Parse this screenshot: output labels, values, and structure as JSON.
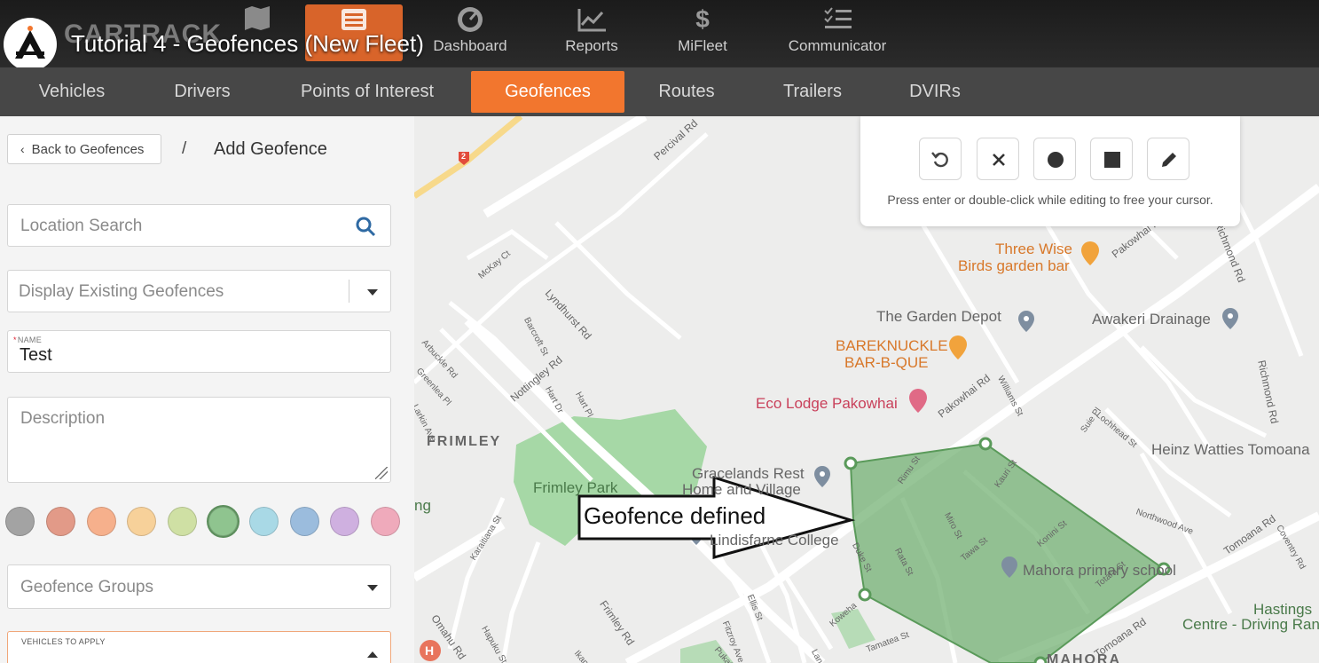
{
  "video": {
    "title": "Tutorial 4 - Geofences (New Fleet)",
    "brand": "CARTRACK"
  },
  "topnav": {
    "items": [
      {
        "label": "Maps",
        "icon": "map-icon"
      },
      {
        "label": "List",
        "icon": "list-icon",
        "active": true
      },
      {
        "label": "Dashboard",
        "icon": "gauge-icon"
      },
      {
        "label": "Reports",
        "icon": "chart-icon"
      },
      {
        "label": "MiFleet",
        "icon": "dollar-icon"
      },
      {
        "label": "Communicator",
        "icon": "checklist-icon"
      }
    ]
  },
  "subnav": {
    "items": [
      "Vehicles",
      "Drivers",
      "Points of Interest",
      "Geofences",
      "Routes",
      "Trailers",
      "DVIRs"
    ],
    "active": "Geofences"
  },
  "panel": {
    "back_label": "Back to Geofences",
    "crumb_sep": "/",
    "title": "Add Geofence",
    "location_search_placeholder": "Location Search",
    "display_existing_label": "Display Existing Geofences",
    "name_label": "NAME",
    "name_value": "Test",
    "description_placeholder": "Description",
    "geofence_groups_label": "Geofence Groups",
    "vehicles_label": "VEHICLES TO APPLY",
    "colors": [
      "#a3a3a3",
      "#e29a88",
      "#f6b08c",
      "#f7d19a",
      "#cfe0a4",
      "#8fc48f",
      "#a9d9e6",
      "#9bbcdd",
      "#cfb0e0",
      "#efaabb"
    ],
    "selected_color_index": 5
  },
  "map": {
    "toolbar_hint": "Press enter or double-click while editing to free your cursor.",
    "tools": [
      "undo-icon",
      "close-icon",
      "circle-icon",
      "square-icon",
      "pencil-icon"
    ],
    "callout": "Geofence defined",
    "area_labels": {
      "frimley": "FRIMLEY",
      "mahora": "MAHORA"
    },
    "places": {
      "three_wise_1": "Three Wise",
      "three_wise_2": "Birds garden bar",
      "garden_depot": "The Garden Depot",
      "awakeri": "Awakeri Drainage",
      "bareknuckle_1": "BAREKNUCKLE",
      "bareknuckle_2": "BAR-B-QUE",
      "eco_lodge": "Eco Lodge Pakowhai",
      "heinz": "Heinz Watties Tomoana",
      "gracelands_1": "Gracelands Rest",
      "gracelands_2": "Home and Village",
      "frimley_park": "Frimley Park",
      "lindisfarne": "Lindisfarne College",
      "mahora_school": "Mahora primary school",
      "hastings_1": "Hastings",
      "hastings_2": "Centre - Driving Ran",
      "left_ng": "ng"
    },
    "streets": {
      "percival": "Percival Rd",
      "lyndhurst": "Lyndhurst Rd",
      "nottingley": "Nottingley Rd",
      "pakowhai": "Pakowhai Rd",
      "pakowhai2": "Pakowhai Rd",
      "richmond": "Richmond Rd",
      "richmond2": "Richmond Rd",
      "frimley_rd": "Frimley Rd",
      "omahu": "Omahu Rd",
      "tomoana": "Tomoana Rd",
      "tomoana2": "Tomoana Rd",
      "williams": "Williams St",
      "mckay": "McKay Ct",
      "barcroft": "Barcroft St",
      "arbuckle": "Arbuckle Rd",
      "greenlea": "Greenlea Pl",
      "hart": "Hart Dr",
      "hart_pl": "Hart Pl",
      "larkin": "Larkin Ave",
      "karaitiana": "Karaitiana St",
      "hapuku": "Hapuku St",
      "ellis": "Ellis St",
      "fitzroy": "Fitzroy Ave",
      "lane": "Lane St",
      "tamatea": "Tamatea St",
      "rata": "Rata St",
      "miro": "Miro St",
      "tawa": "Tawa St",
      "rimu": "Rimu St",
      "kauri": "Kauri St",
      "konini": "Konini St",
      "totara": "Totara St",
      "duke": "Duke St",
      "koweha": "Koweha",
      "lochhead": "Lochhead St",
      "northwood": "Northwood Ave",
      "coventry": "Coventry Rd",
      "suie": "Suie Pl",
      "ikanui": "Ikanui",
      "pukatea": "Pukatea",
      "route_2": "2",
      "hospital": "H"
    }
  }
}
